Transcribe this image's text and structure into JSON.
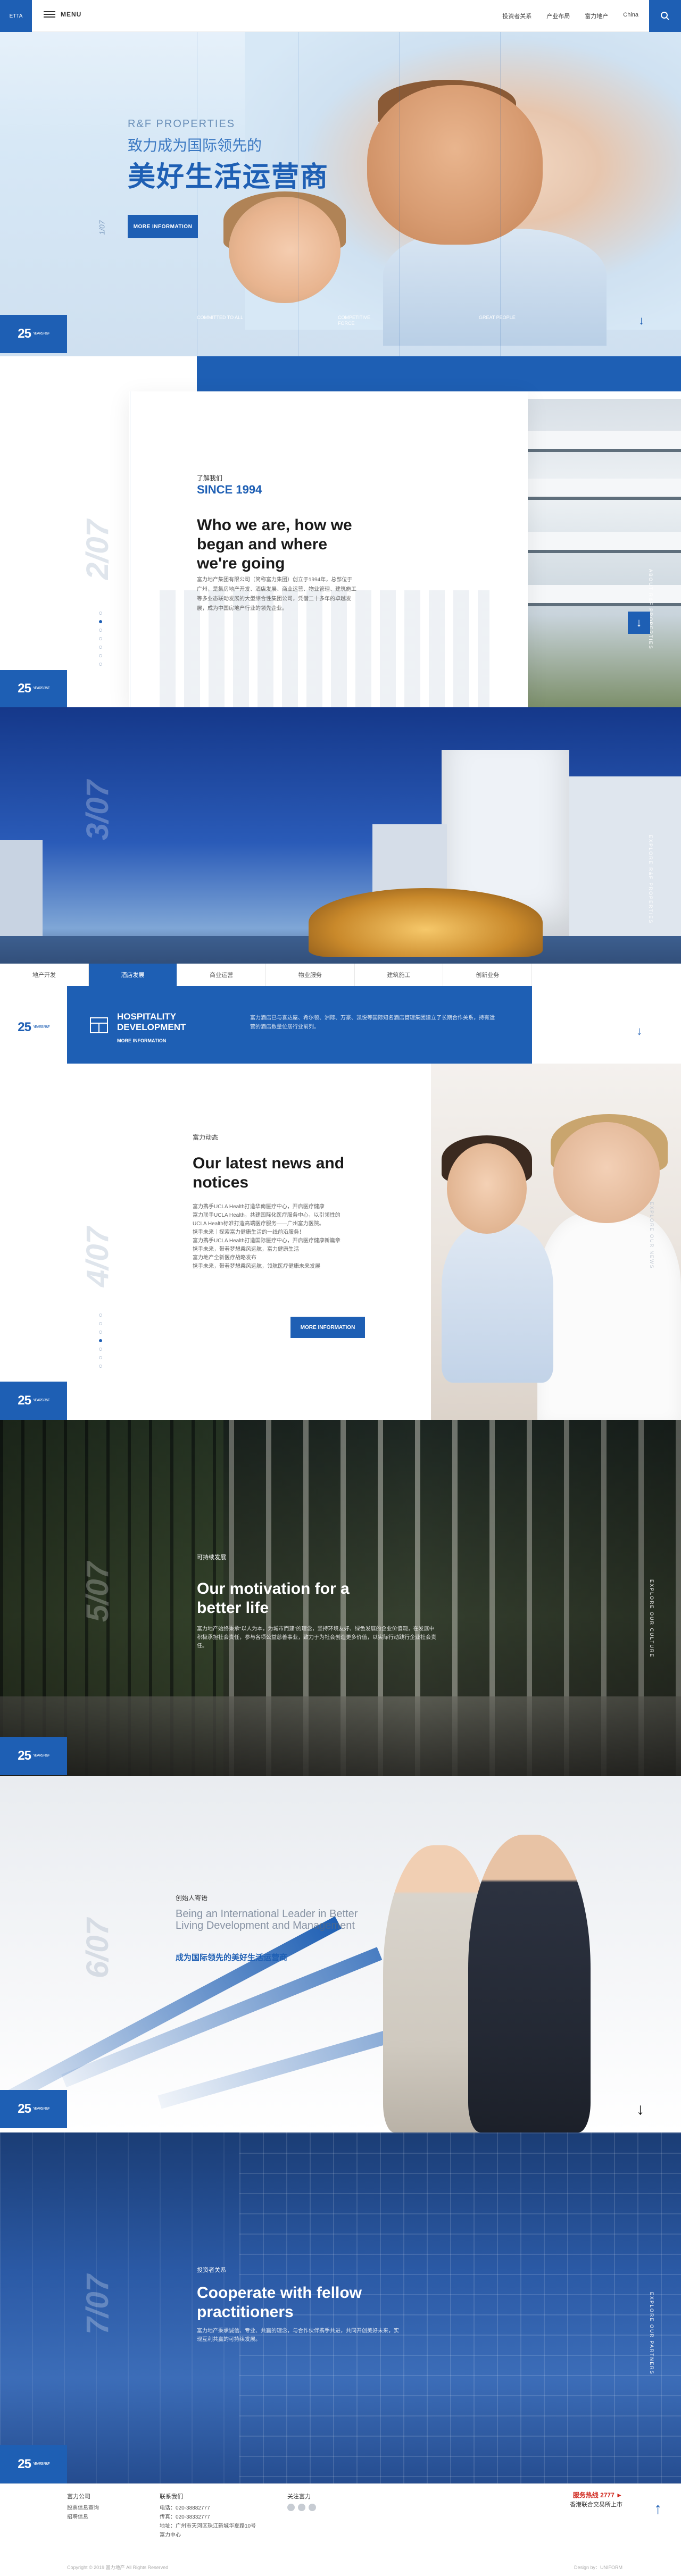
{
  "header": {
    "logo_text": "ETTA",
    "menu_label": "MENU",
    "nav": [
      "投资者关系",
      "产业布局",
      "富力地产",
      "China"
    ]
  },
  "hero": {
    "subtitle_en": "R&F PROPERTIES",
    "subtitle_cn": "致力成为国际领先的",
    "title_cn": "美好生活运营商",
    "button": "MORE INFORMATION",
    "page_indicator": "1/07",
    "stats": [
      {
        "label": "COMMITTED TO ALL"
      },
      {
        "label": "COMPETITIVE FORCE"
      },
      {
        "label": "GREAT PEOPLE"
      }
    ]
  },
  "brand_badge": {
    "main": "25",
    "sub": "YEARS R&F"
  },
  "about": {
    "small": "了解我们",
    "year": "SINCE 1994",
    "title": "Who we are, how we began and where we're going",
    "body": "富力地产集团有限公司（简称富力集团）创立于1994年，总部位于广州，是集房地产开发、酒店发展、商业运营、物业管理、建筑施工等多业态联动发展的大型综合性集团公司，凭借二十多年的卓越发展，成为中国房地产行业的领先企业。",
    "side_num": "2/07",
    "side_label": "ABOUT R&F PROPERTIES"
  },
  "hospitality": {
    "side_num": "3/07",
    "tabs": [
      "地产开发",
      "酒店发展",
      "商业运营",
      "物业服务",
      "建筑施工",
      "创新业务"
    ],
    "active_tab": "酒店发展",
    "title": "HOSPITALITY DEVELOPMENT",
    "more": "MORE INFORMATION",
    "body": "富力酒店已与喜达屋、希尔顿、洲际、万豪、凯悦等国际知名酒店管理集团建立了长期合作关系，持有运营的酒店数量位居行业前列。",
    "side_label": "EXPLORE R&F PROPERTIES"
  },
  "news": {
    "small": "富力动态",
    "title": "Our latest news and notices",
    "items": [
      "富力携手UCLA Health打造华南医疗中心，开启医疗健康",
      "富力联手UCLA Health，共建国际化医疗服务中心，以引领性的UCLA Health标准打造高端医疗服务——广州富力医院。",
      "携手未来｜探索富力健康生活的一线前沿服务！",
      "富力携手UCLA Health打造国际医疗中心，开启医疗健康新篇章",
      "携手未来，带着梦想乘风远航，富力健康生活",
      "富力地产全新医疗战略发布",
      "携手未来，带着梦想乘风远航，领航医疗健康未来发展"
    ],
    "button": "MORE INFORMATION",
    "side_num": "4/07",
    "side_label": "EXPLORE OUR NEWS"
  },
  "culture": {
    "small": "可持续发展",
    "title": "Our motivation for a better life",
    "body": "富力地产始终秉承“以人为本，为城市而建”的理念，坚持环境友好、绿色发展的企业价值观，在发展中积极承担社会责任，参与各项公益慈善事业，致力于为社会创造更多价值，以实际行动践行企业社会责任。",
    "side_num": "5/07",
    "side_label": "EXPLORE OUR CULTURE"
  },
  "founders": {
    "small": "创始人寄语",
    "title": "Being an International Leader in Better Living Development and Management",
    "title_cn": "成为国际领先的美好生活运营商",
    "side_num": "6/07"
  },
  "cooperate": {
    "small": "投资者关系",
    "title": "Cooperate with fellow practitioners",
    "body": "富力地产秉承诚信、专业、共赢的理念，与合作伙伴携手共进，共同开创美好未来，实现互利共赢的可持续发展。",
    "side_num": "7/07",
    "side_label": "EXPLORE OUR PARTNERS"
  },
  "footer": {
    "col1_title": "富力公司",
    "col1_links": [
      "股票信息查询",
      "招聘信息"
    ],
    "col2_title": "联系我们",
    "col2_lines": [
      "电话：020-38882777",
      "传真：020-38332777",
      "地址：广州市天河区珠江新城华夏路10号",
      "富力中心"
    ],
    "col3_title": "关注富力",
    "hotline": "服务热线 2777 ►",
    "stock": "香港联合交易所上市",
    "copyright": "Copyright © 2019 富力地产 All Rights Reserved",
    "powered": "Design by：UNIFORM"
  },
  "colors": {
    "brand": "#1e5fb4"
  }
}
